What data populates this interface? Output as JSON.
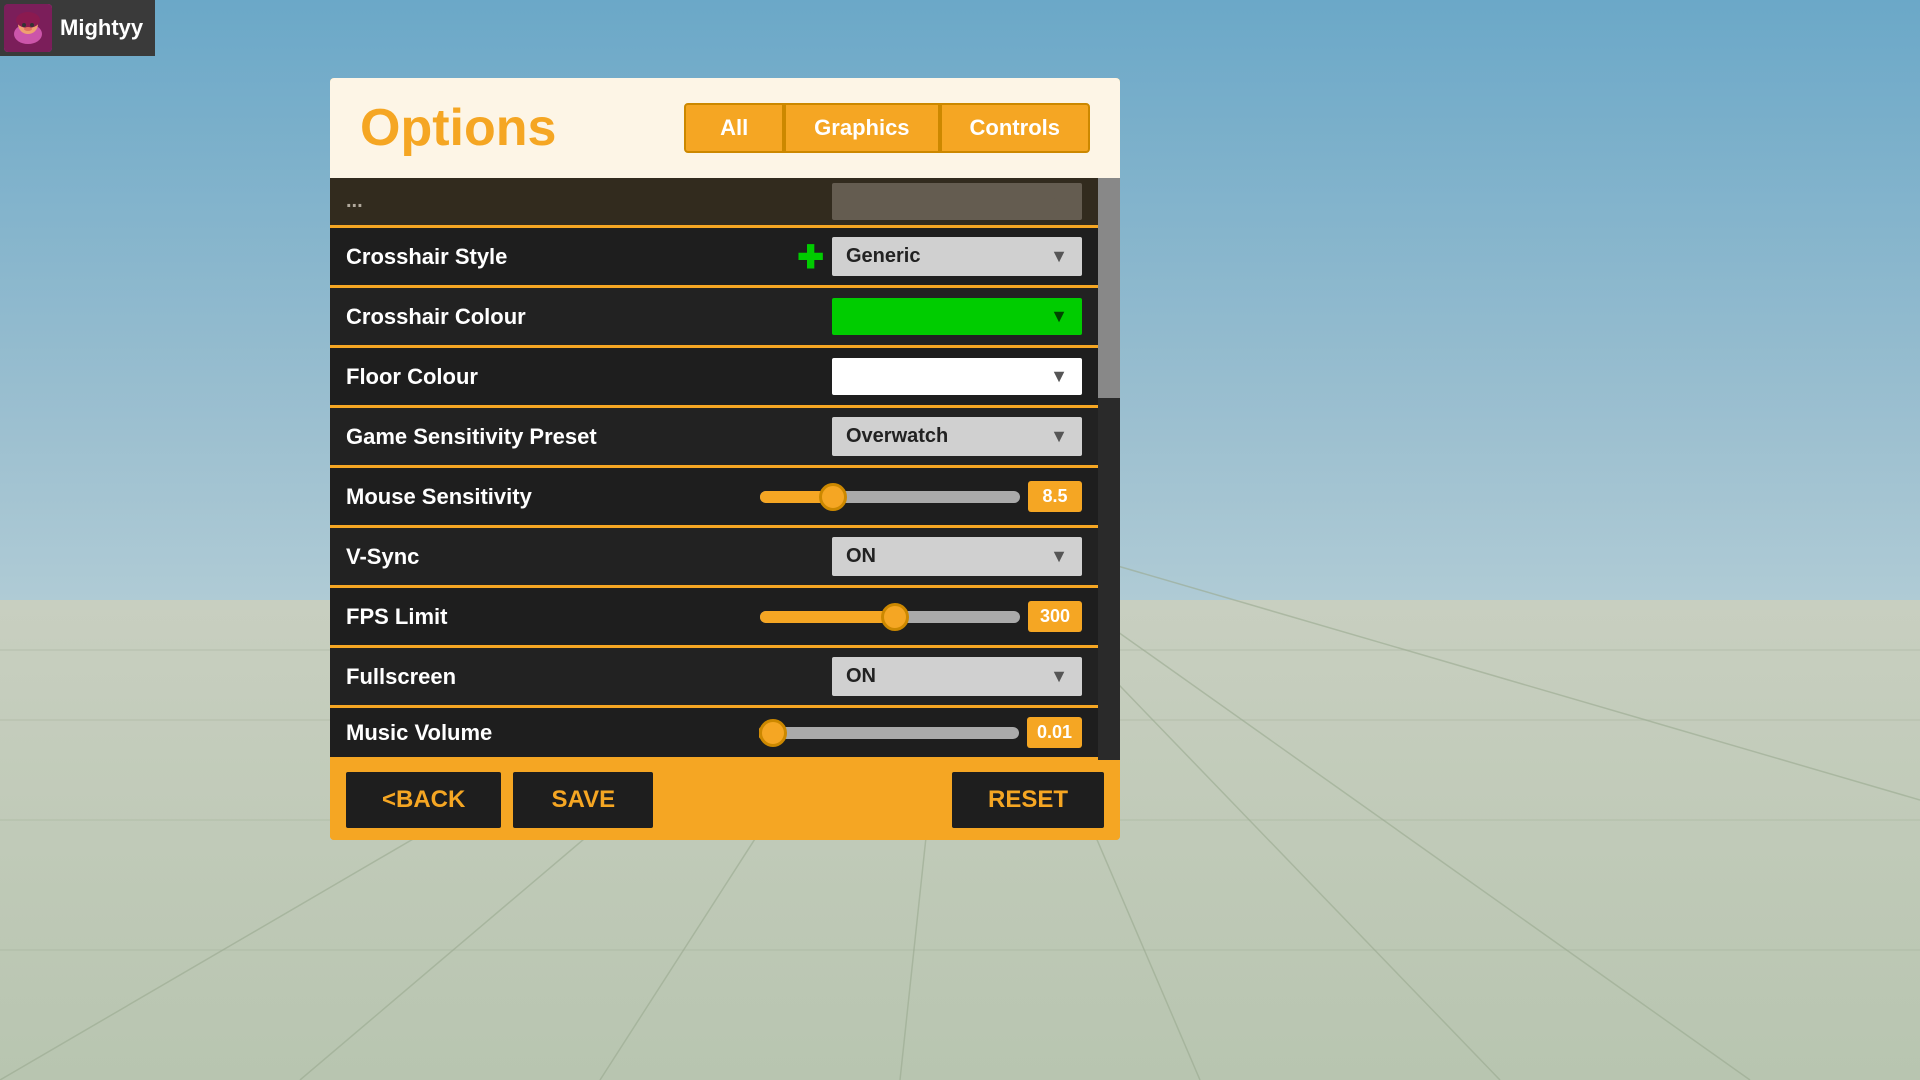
{
  "user": {
    "name": "Mightyy"
  },
  "modal": {
    "title": "Options",
    "tabs": [
      {
        "label": "All",
        "active": true
      },
      {
        "label": "Graphics",
        "active": false
      },
      {
        "label": "Controls",
        "active": false
      }
    ]
  },
  "settings": {
    "rows": [
      {
        "label": "Crosshair Style",
        "type": "dropdown",
        "value": "Generic",
        "has_crosshair_icon": true
      },
      {
        "label": "Crosshair Colour",
        "type": "dropdown-green",
        "value": ""
      },
      {
        "label": "Floor Colour",
        "type": "dropdown-white",
        "value": ""
      },
      {
        "label": "Game Sensitivity Preset",
        "type": "dropdown",
        "value": "Overwatch"
      },
      {
        "label": "Mouse Sensitivity",
        "type": "slider",
        "value": "8.5",
        "fill_pct": 28
      },
      {
        "label": "V-Sync",
        "type": "dropdown",
        "value": "ON"
      },
      {
        "label": "FPS Limit",
        "type": "slider",
        "value": "300",
        "fill_pct": 52
      },
      {
        "label": "Fullscreen",
        "type": "dropdown",
        "value": "ON"
      },
      {
        "label": "Music Volume",
        "type": "slider",
        "value": "0.01",
        "fill_pct": 2
      }
    ]
  },
  "footer": {
    "back_label": "<BACK",
    "save_label": "SAVE",
    "reset_label": "RESET"
  }
}
